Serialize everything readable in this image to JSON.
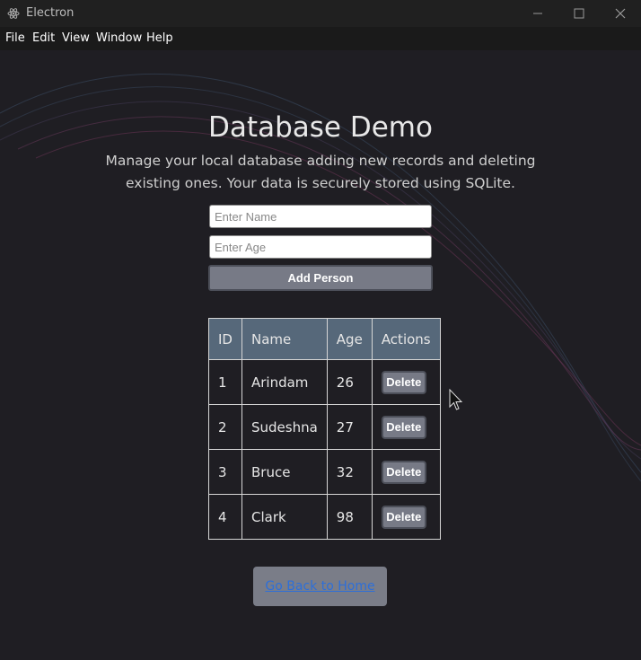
{
  "window": {
    "title": "Electron",
    "app_icon": "electron-atom-icon",
    "controls": [
      "minimize-icon",
      "maximize-icon",
      "close-icon"
    ]
  },
  "menu": {
    "items": [
      {
        "label": "File"
      },
      {
        "label": "Edit"
      },
      {
        "label": "View"
      },
      {
        "label": "Window"
      },
      {
        "label": "Help"
      }
    ]
  },
  "page": {
    "heading": "Database Demo",
    "subtitle": "Manage your local database adding new records and deleting existing ones. Your data is securely stored using SQLite."
  },
  "form": {
    "name_placeholder": "Enter Name",
    "name_value": "",
    "age_placeholder": "Enter Age",
    "age_value": "",
    "add_label": "Add Person"
  },
  "table": {
    "headers": [
      "ID",
      "Name",
      "Age",
      "Actions"
    ],
    "rows": [
      {
        "id": "1",
        "name": "Arindam",
        "age": "26",
        "action": "Delete"
      },
      {
        "id": "2",
        "name": "Sudeshna",
        "age": "27",
        "action": "Delete"
      },
      {
        "id": "3",
        "name": "Bruce",
        "age": "32",
        "action": "Delete"
      },
      {
        "id": "4",
        "name": "Clark",
        "age": "98",
        "action": "Delete"
      }
    ]
  },
  "footer": {
    "home_link": "Go Back to Home"
  },
  "colors": {
    "background": "#1f1e23",
    "table_header": "#56687a",
    "button": "#777a86",
    "link": "#2e6fd8"
  }
}
